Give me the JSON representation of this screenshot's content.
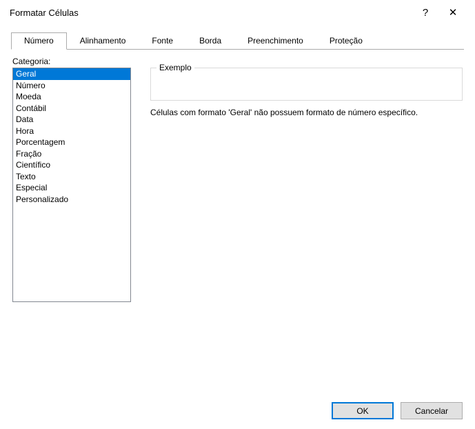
{
  "title": "Formatar Células",
  "help_symbol": "?",
  "close_symbol": "✕",
  "tabs": [
    {
      "label": "Número",
      "active": true
    },
    {
      "label": "Alinhamento",
      "active": false
    },
    {
      "label": "Fonte",
      "active": false
    },
    {
      "label": "Borda",
      "active": false
    },
    {
      "label": "Preenchimento",
      "active": false
    },
    {
      "label": "Proteção",
      "active": false
    }
  ],
  "category_label": "Categoria:",
  "categories": [
    {
      "label": "Geral",
      "selected": true
    },
    {
      "label": "Número",
      "selected": false
    },
    {
      "label": "Moeda",
      "selected": false
    },
    {
      "label": "Contábil",
      "selected": false
    },
    {
      "label": "Data",
      "selected": false
    },
    {
      "label": "Hora",
      "selected": false
    },
    {
      "label": "Porcentagem",
      "selected": false
    },
    {
      "label": "Fração",
      "selected": false
    },
    {
      "label": "Científico",
      "selected": false
    },
    {
      "label": "Texto",
      "selected": false
    },
    {
      "label": "Especial",
      "selected": false
    },
    {
      "label": "Personalizado",
      "selected": false
    }
  ],
  "example_label": "Exemplo",
  "description": "Células com formato 'Geral' não possuem formato de número específico.",
  "buttons": {
    "ok": "OK",
    "cancel": "Cancelar"
  }
}
